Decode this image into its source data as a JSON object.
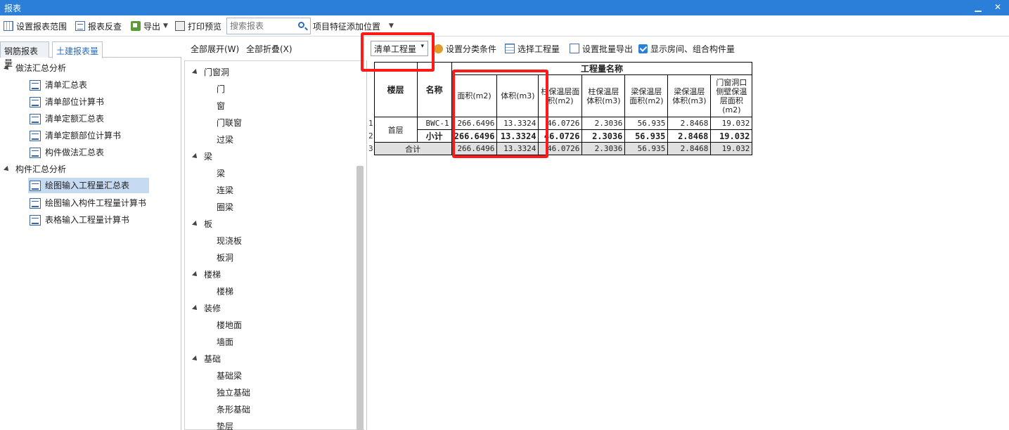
{
  "window": {
    "title": "报表"
  },
  "toolbar": {
    "set_range": "设置报表范围",
    "review": "报表反查",
    "export": "导出",
    "print_preview": "打印预览",
    "search_placeholder": "搜索报表",
    "feature_position": "项目特征添加位置"
  },
  "tabs": [
    "钢筋报表量",
    "土建报表量"
  ],
  "left_tree": {
    "group1": "做法汇总分析",
    "group1_items": [
      "清单汇总表",
      "清单部位计算书",
      "清单定额汇总表",
      "清单定额部位计算书",
      "构件做法汇总表"
    ],
    "group2": "构件汇总分析",
    "group2_items": [
      "绘图输入工程量汇总表",
      "绘图输入构件工程量计算书",
      "表格输入工程量计算书"
    ]
  },
  "mid": {
    "expand_all": "全部展开(W)",
    "collapse_all": "全部折叠(X)",
    "groups": [
      {
        "label": "门窗洞",
        "items": [
          "门",
          "窗",
          "门联窗",
          "过梁"
        ]
      },
      {
        "label": "梁",
        "items": [
          "梁",
          "连梁",
          "圈梁"
        ]
      },
      {
        "label": "板",
        "items": [
          "现浇板",
          "板洞"
        ]
      },
      {
        "label": "楼梯",
        "items": [
          "楼梯"
        ]
      },
      {
        "label": "装修",
        "items": [
          "楼地面",
          "墙面"
        ]
      },
      {
        "label": "基础",
        "items": [
          "基础梁",
          "独立基础",
          "条形基础",
          "垫层"
        ]
      }
    ]
  },
  "right_toolbar": {
    "dropdown": "清单工程量",
    "set_category": "设置分类条件",
    "select_quantity": "选择工程量",
    "batch_export": "设置批量导出",
    "show_rooms": "显示房间、组合构件量"
  },
  "report": {
    "header_floor": "楼层",
    "header_name": "名称",
    "header_group": "工程量名称",
    "columns": [
      "面积(m2)",
      "体积(m3)",
      "柱保温层面积(m2)",
      "柱保温层体积(m3)",
      "梁保温层面积(m2)",
      "梁保温层体积(m3)",
      "门窗洞口侧壁保温层面积(m2)"
    ],
    "row_numbers": [
      "1",
      "2",
      "3"
    ],
    "floor": "首层",
    "rows": [
      {
        "name": "BWC-1",
        "values": [
          "266.6496",
          "13.3324",
          "46.0726",
          "2.3036",
          "56.935",
          "2.8468",
          "19.032"
        ]
      },
      {
        "name": "小计",
        "values": [
          "266.6496",
          "13.3324",
          "46.0726",
          "2.3036",
          "56.935",
          "2.8468",
          "19.032"
        ]
      }
    ],
    "total_label": "合计",
    "total_values": [
      "266.6496",
      "13.3324",
      "46.0726",
      "2.3036",
      "56.935",
      "2.8468",
      "19.032"
    ]
  }
}
